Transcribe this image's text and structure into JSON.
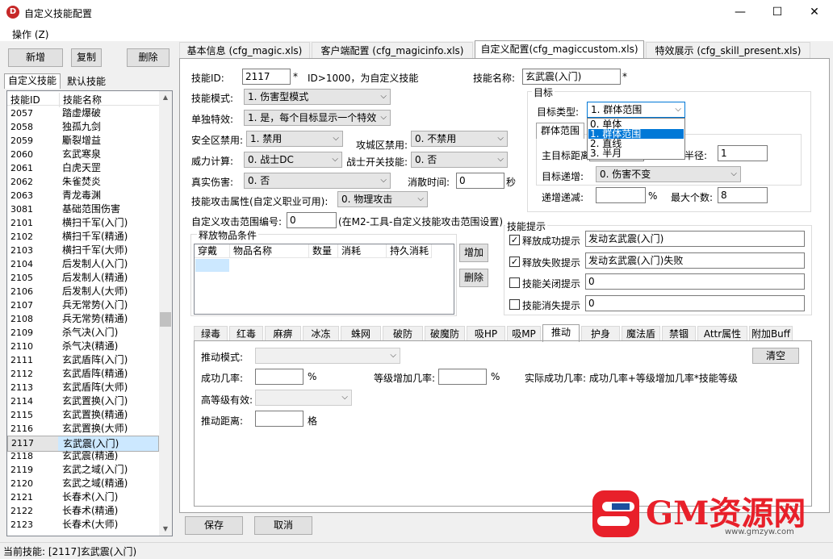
{
  "window": {
    "title": "自定义技能配置",
    "minimize": "—",
    "maximize": "☐",
    "close": "✕"
  },
  "menu": {
    "operation": "操作 (Z)"
  },
  "left": {
    "add": "新增",
    "copy": "复制",
    "delete": "删除",
    "tab_custom": "自定义技能",
    "tab_default": "默认技能",
    "col_id": "技能ID",
    "col_name": "技能名称",
    "rows": [
      [
        "2057",
        "踏虚爆破"
      ],
      [
        "2058",
        "独孤九剑"
      ],
      [
        "2059",
        "斸裂增益"
      ],
      [
        "2060",
        "玄武寒泉"
      ],
      [
        "2061",
        "白虎天罡"
      ],
      [
        "2062",
        "朱雀焚炎"
      ],
      [
        "2063",
        "青龙毒渊"
      ],
      [
        "3081",
        "基础范围伤害"
      ],
      [
        "2101",
        "横扫千军(入门)"
      ],
      [
        "2102",
        "横扫千军(精通)"
      ],
      [
        "2103",
        "横扫千军(大师)"
      ],
      [
        "2104",
        "后发制人(入门)"
      ],
      [
        "2105",
        "后发制人(精通)"
      ],
      [
        "2106",
        "后发制人(大师)"
      ],
      [
        "2107",
        "兵无常势(入门)"
      ],
      [
        "2108",
        "兵无常势(精通)"
      ],
      [
        "2109",
        "杀气决(入门)"
      ],
      [
        "2110",
        "杀气决(精通)"
      ],
      [
        "2111",
        "玄武盾阵(入门)"
      ],
      [
        "2112",
        "玄武盾阵(精通)"
      ],
      [
        "2113",
        "玄武盾阵(大师)"
      ],
      [
        "2114",
        "玄武置换(入门)"
      ],
      [
        "2115",
        "玄武置换(精通)"
      ],
      [
        "2116",
        "玄武置换(大师)"
      ],
      [
        "2117",
        "玄武震(入门)"
      ],
      [
        "2118",
        "玄武震(精通)"
      ],
      [
        "2119",
        "玄武之域(入门)"
      ],
      [
        "2120",
        "玄武之域(精通)"
      ],
      [
        "2121",
        "长春术(入门)"
      ],
      [
        "2122",
        "长春术(精通)"
      ],
      [
        "2123",
        "长春术(大师)"
      ]
    ],
    "selected_index": 24
  },
  "tabs": [
    "基本信息 (cfg_magic.xls)",
    "客户端配置 (cfg_magicinfo.xls)",
    "自定义配置(cfg_magiccustom.xls)",
    "特效展示 (cfg_skill_present.xls)"
  ],
  "form": {
    "skill_id_label": "技能ID:",
    "skill_id": "2117",
    "star": "*",
    "id_hint": "ID>1000，为自定义技能",
    "skill_name_label": "技能名称:",
    "skill_name": "玄武震(入门)",
    "mode_label": "技能模式:",
    "mode": "1. 伤害型模式",
    "single_label": "单独特效:",
    "single": "1. 是，每个目标显示一个特效",
    "safe_label": "安全区禁用:",
    "safe": "1. 禁用",
    "siege_label": "攻城区禁用:",
    "siege": "0. 不禁用",
    "power_label": "威力计算:",
    "power": "0. 战士DC",
    "switch_label": "战士开关技能:",
    "switch": "0. 否",
    "true_label": "真实伤害:",
    "true_dmg": "0. 否",
    "vanish_label": "消散时间:",
    "vanish": "0",
    "sec": "秒",
    "attr_label": "技能攻击属性(自定义职业可用):",
    "attr": "0. 物理攻击",
    "range_label": "自定义攻击范围编号:",
    "range": "0",
    "range_hint": "(在M2-工具-自定义技能攻击范围设置)"
  },
  "release": {
    "title": "释放物品条件",
    "cols": [
      "穿戴",
      "物品名称",
      "数量",
      "消耗",
      "持久消耗"
    ],
    "add": "增加",
    "delete": "删除"
  },
  "target": {
    "title": "目标",
    "type_label": "目标类型:",
    "type": "1. 群体范围",
    "tab": "群体范围",
    "main_label": "主目标距离",
    "radius_label": "半径:",
    "radius": "1",
    "dec_label": "目标递增:",
    "dec": "0. 伤害不变",
    "ratio_label": "递增递减:",
    "pct": "%",
    "max_label": "最大个数:",
    "max": "8",
    "options": [
      "0. 单体",
      "1. 群体范围",
      "2. 直线",
      "3. 半月"
    ],
    "highlight": 1
  },
  "hints": {
    "title": "技能提示",
    "items": [
      {
        "label": "释放成功提示",
        "checked": true,
        "value": "发动玄武震(入门)"
      },
      {
        "label": "释放失败提示",
        "checked": true,
        "value": "发动玄武震(入门)失败"
      },
      {
        "label": "技能关闭提示",
        "checked": false,
        "value": "0"
      },
      {
        "label": "技能消失提示",
        "checked": false,
        "value": "0"
      }
    ]
  },
  "subtabs": [
    "绿毒",
    "红毒",
    "麻痹",
    "冰冻",
    "蛛网",
    "破防",
    "破魔防",
    "吸HP",
    "吸MP",
    "推动",
    "护身",
    "魔法盾",
    "禁锢",
    "Attr属性",
    "附加Buff"
  ],
  "push": {
    "mode_label": "推动模式:",
    "clear": "清空",
    "rate_label": "成功几率:",
    "pct": "%",
    "level_label": "等级增加几率:",
    "actual": "实际成功几率: 成功几率+等级增加几率*技能等级",
    "high_label": "高等级有效:",
    "dist_label": "推动距离:",
    "unit": "格"
  },
  "footer": {
    "save": "保存",
    "cancel": "取消"
  },
  "status": "当前技能:  [2117]玄武震(入门)",
  "logo": {
    "text": "GM资源网",
    "url": "www.gmzyw.com"
  },
  "colors": {
    "selection": "#cce8ff",
    "highlight": "#0078d7",
    "logo_red": "#e8202a",
    "logo_blue": "#1d4f9e"
  }
}
